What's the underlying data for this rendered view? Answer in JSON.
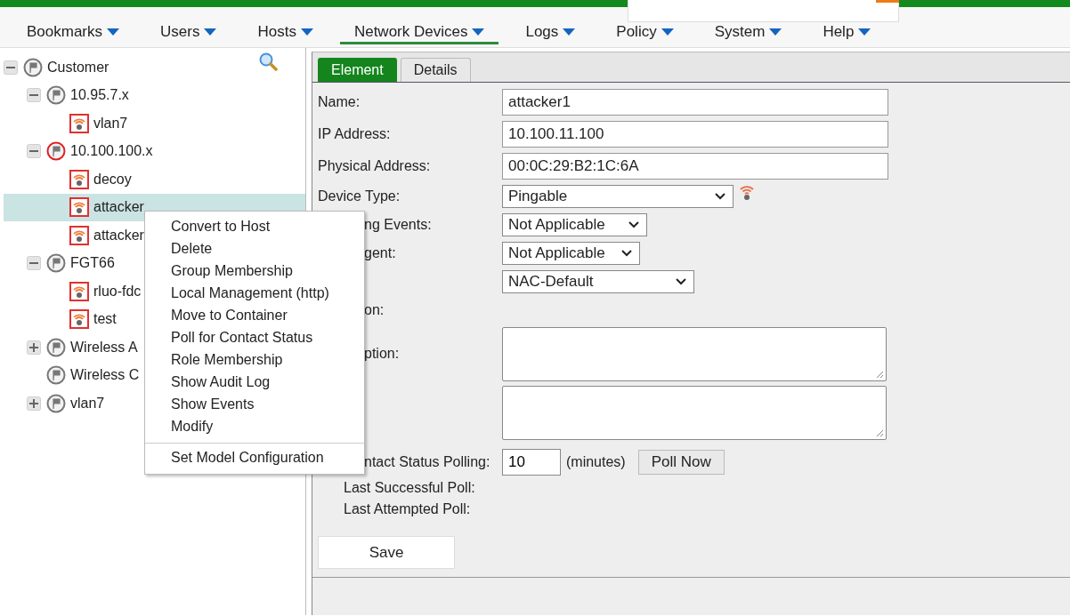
{
  "menu_bar": [
    {
      "label": "Bookmarks",
      "selected": false
    },
    {
      "label": "Users",
      "selected": false
    },
    {
      "label": "Hosts",
      "selected": false
    },
    {
      "label": "Network Devices",
      "selected": true
    },
    {
      "label": "Logs",
      "selected": false
    },
    {
      "label": "Policy",
      "selected": false
    },
    {
      "label": "System",
      "selected": false
    },
    {
      "label": "Help",
      "selected": false
    }
  ],
  "tree": [
    {
      "label": "Customer",
      "kind": "container",
      "alert": false,
      "expanded": true,
      "selected": false,
      "children": [
        {
          "label": "10.95.7.x",
          "kind": "container",
          "alert": false,
          "expanded": true,
          "selected": false,
          "children": [
            {
              "label": "vlan7",
              "kind": "device",
              "selected": false
            }
          ]
        },
        {
          "label": "10.100.100.x",
          "kind": "container",
          "alert": true,
          "expanded": true,
          "selected": false,
          "children": [
            {
              "label": "decoy",
              "kind": "device",
              "selected": false
            },
            {
              "label": "attacker",
              "kind": "device",
              "selected": true
            },
            {
              "label": "attacker",
              "kind": "device",
              "selected": false
            }
          ]
        },
        {
          "label": "FGT66",
          "kind": "container",
          "alert": false,
          "expanded": true,
          "selected": false,
          "children": [
            {
              "label": "rluo-fdc",
              "kind": "device",
              "selected": false
            },
            {
              "label": "test",
              "kind": "device",
              "selected": false
            }
          ]
        },
        {
          "label": "Wireless A",
          "kind": "container",
          "alert": false,
          "expanded": false,
          "selected": false
        },
        {
          "label": "Wireless C",
          "kind": "container",
          "alert": false,
          "selected": false
        },
        {
          "label": "vlan7",
          "kind": "container",
          "alert": false,
          "expanded": false,
          "selected": false
        }
      ]
    }
  ],
  "context_menu": {
    "items": [
      "Convert to Host",
      "Delete",
      "Group Membership",
      "Local Management (http)",
      "Move to Container",
      "Poll for Contact Status",
      "Role Membership",
      "Show Audit Log",
      "Show Events",
      "Modify"
    ],
    "footer_items": [
      "Set Model Configuration"
    ]
  },
  "tabs": [
    {
      "label": "Element",
      "selected": true
    },
    {
      "label": "Details",
      "selected": false
    }
  ],
  "form": [
    {
      "kind": "text",
      "label": "Name:",
      "value": "attacker1"
    },
    {
      "kind": "text",
      "label": "IP Address:",
      "value": "10.100.11.100"
    },
    {
      "kind": "text",
      "label": "Physical Address:",
      "value": "00:0C:29:B2:1C:6A"
    },
    {
      "kind": "select",
      "label": "Device Type:",
      "value": "Pingable"
    },
    {
      "kind": "select",
      "label": "ng Events:",
      "cut": true,
      "value": "Not Applicable"
    },
    {
      "kind": "select",
      "label": "gent:",
      "cut": true,
      "value": "Not Applicable"
    },
    {
      "kind": "select",
      "value": "NAC-Default"
    },
    {
      "kind": "label",
      "label": "on:",
      "cut": true
    },
    {
      "kind": "textarea",
      "label": "ption:",
      "cut": true
    },
    {
      "kind": "textarea"
    },
    {
      "kind": "polling",
      "label": "ntact Status Polling:",
      "cut": true,
      "value": "10",
      "unit": "(minutes)",
      "button": "Poll Now"
    },
    {
      "kind": "info",
      "label": "Last Successful Poll:"
    },
    {
      "kind": "info",
      "label": "Last Attempted Poll:"
    }
  ],
  "save_button": "Save"
}
